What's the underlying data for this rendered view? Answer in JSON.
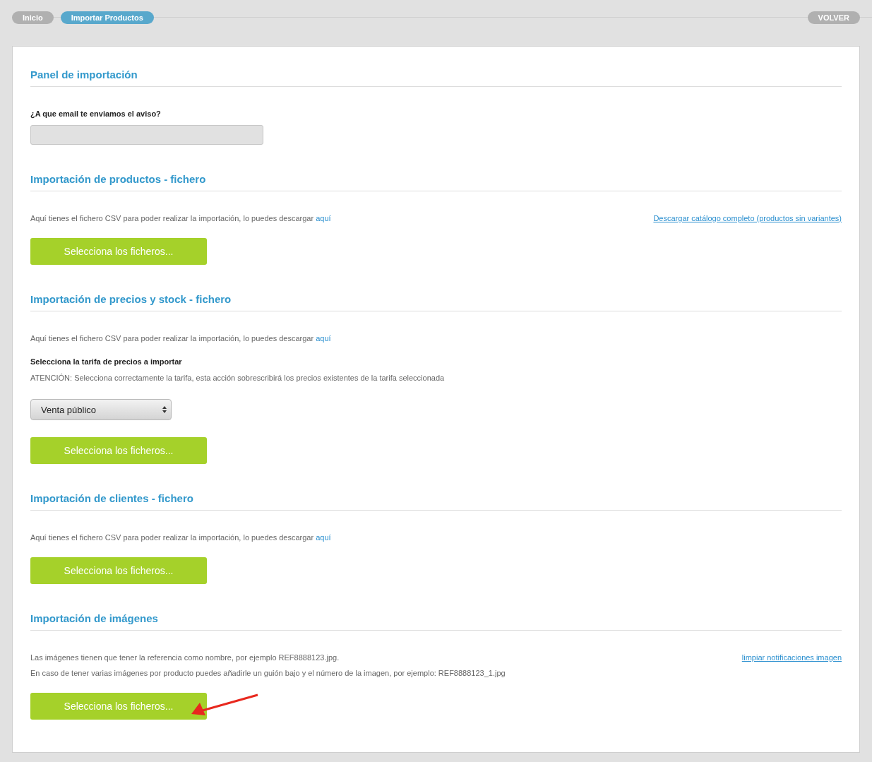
{
  "breadcrumbs": [
    {
      "label": "Inicio",
      "selected": false
    },
    {
      "label": "Importar Productos",
      "selected": true
    }
  ],
  "back_button": "VOLVER",
  "sections": [
    {
      "title": "Panel de importación",
      "blocks": [
        {
          "kind": "label",
          "text": "¿A que email te enviamos el aviso?"
        },
        {
          "kind": "field"
        }
      ]
    },
    {
      "title": "Importación de productos - fichero",
      "blocks": [
        {
          "kind": "text",
          "text": "Aquí tienes el fichero CSV para poder realizar la importación, lo puedes descargar",
          "link": "aquí",
          "right_link": "Descargar catálogo completo (productos sin variantes)"
        },
        {
          "kind": "upload",
          "text": "Selecciona los ficheros..."
        }
      ]
    },
    {
      "title": "Importación de precios y stock - fichero",
      "blocks": [
        {
          "kind": "text",
          "text": "Aquí tienes el fichero CSV para poder realizar la importación, lo puedes descargar",
          "link": "aquí"
        },
        {
          "kind": "label",
          "text": "Selecciona la tarifa de precios a importar"
        },
        {
          "kind": "note",
          "text": "ATENCIÓN: Selecciona correctamente la tarifa, esta acción sobrescribirá los precios existentes de la tarifa seleccionada"
        },
        {
          "kind": "select",
          "text": "Venta público"
        },
        {
          "kind": "upload",
          "text": "Selecciona los ficheros..."
        }
      ]
    },
    {
      "title": "Importación de clientes - fichero",
      "blocks": [
        {
          "kind": "text",
          "text": "Aquí tienes el fichero CSV para poder realizar la importación, lo puedes descargar",
          "link": "aquí"
        },
        {
          "kind": "upload",
          "text": "Selecciona los ficheros..."
        }
      ]
    },
    {
      "title": "Importación de imágenes",
      "blocks": [
        {
          "kind": "text",
          "text": "Las imágenes tienen que tener la referencia como nombre, por ejemplo REF8888123.jpg.",
          "right_link": "limpiar notificaciones imagen"
        },
        {
          "kind": "text",
          "text": "En caso de tener varias imágenes por producto puedes añadirle un guión bajo y el número de la imagen, por ejemplo: REF8888123_1.jpg"
        },
        {
          "kind": "upload",
          "text": "Selecciona los ficheros...",
          "arrow": true
        }
      ]
    }
  ]
}
